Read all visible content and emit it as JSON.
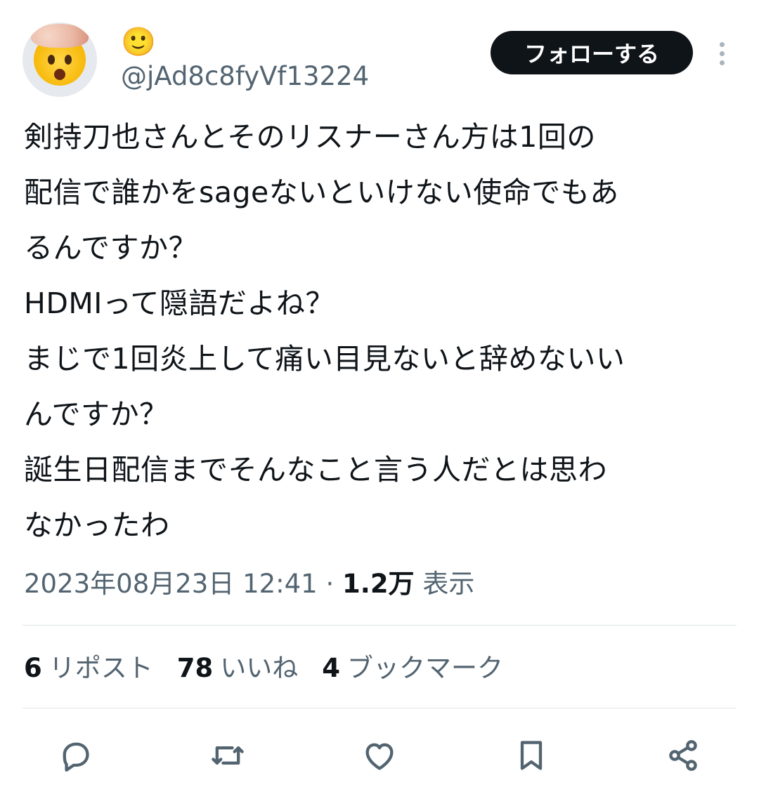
{
  "user": {
    "display_name": "🙂",
    "handle": "@jAd8c8fyVf13224",
    "avatar_icon": "exploding-head-emoji"
  },
  "header": {
    "follow_label": "フォローする"
  },
  "tweet": {
    "lines": [
      "剣持刀也さんとそのリスナーさん方は1回の",
      "配信で誰かをsageないといけない使命でもあ",
      "るんですか？",
      "HDMIって隠語だよね？",
      "まじで1回炎上して痛い目見ないと辞めないい",
      "んですか？",
      "誕生日配信までそんなこと言う人だとは思わ",
      "なかったわ"
    ]
  },
  "meta": {
    "timestamp": "2023年08月23日 12:41",
    "separator": "·",
    "views_count": "1.2万",
    "views_label": "表示"
  },
  "stats": {
    "reposts_count": "6",
    "reposts_label": "リポスト",
    "likes_count": "78",
    "likes_label": "いいね",
    "bookmarks_count": "4",
    "bookmarks_label": "ブックマーク"
  },
  "actions": {
    "icons": [
      "reply-icon",
      "repost-icon",
      "like-icon",
      "bookmark-icon",
      "share-icon"
    ],
    "icon_color": "#536471"
  }
}
